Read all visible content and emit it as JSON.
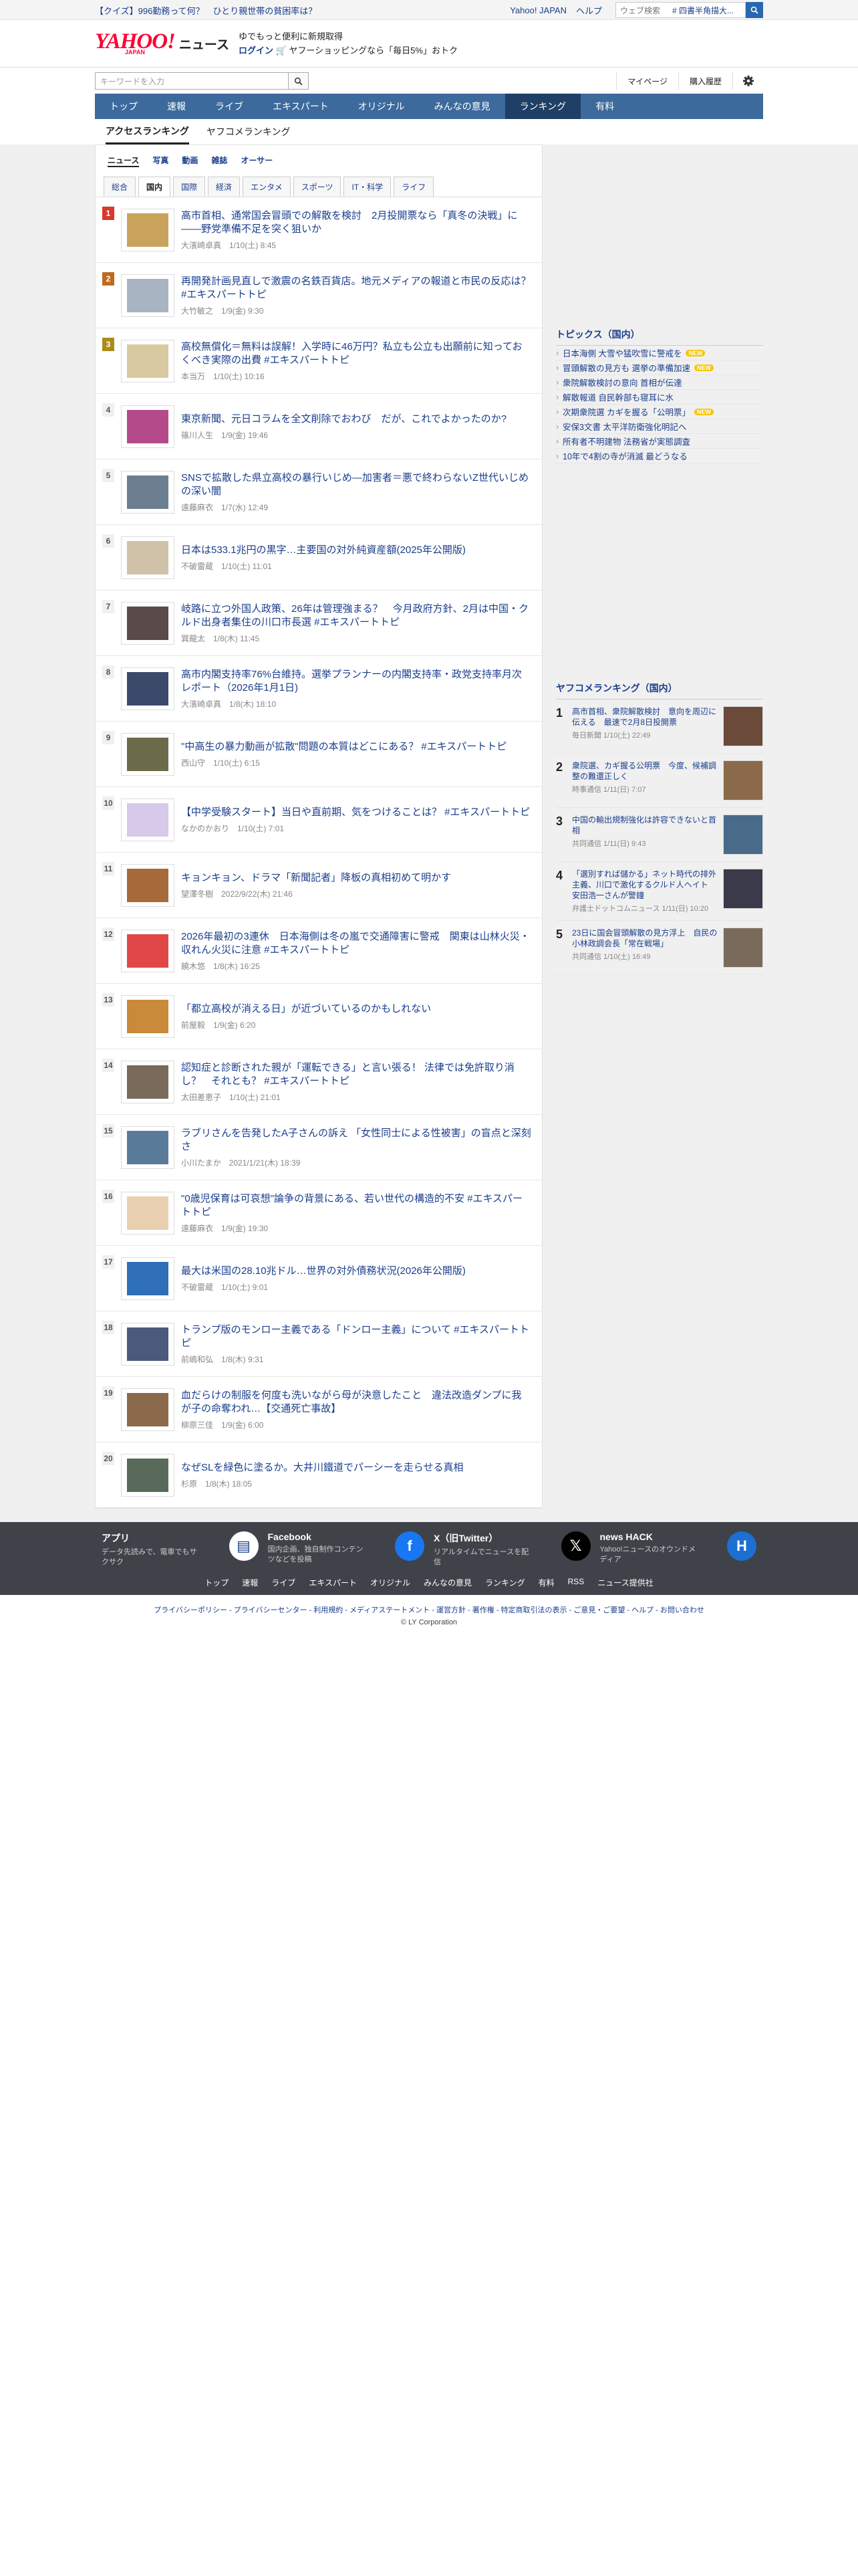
{
  "topbar": {
    "promo": "【クイズ】996勤務って何？　ひとり親世帯の貧困率は？",
    "links": [
      "Yahoo! JAPAN",
      "ヘルプ"
    ],
    "search_placeholder": "ウェブ検索",
    "search_value": "# 四書半角描大..."
  },
  "header": {
    "logo_text": "YAHOO!",
    "logo_sub": "JAPAN",
    "news_label": "ニュース",
    "msg1": "ゆでもっと便利に新規取得",
    "msg_highlight": "新規取得",
    "login": "ログイン",
    "msg2": "ヤフーショッピングなら「毎日5%」おトク"
  },
  "search": {
    "placeholder": "キーワードを入力",
    "mypage": "マイページ",
    "history": "購入履歴"
  },
  "gnav": [
    "トップ",
    "速報",
    "ライブ",
    "エキスパート",
    "オリジナル",
    "みんなの意見",
    "ランキング",
    "有料"
  ],
  "gnav_active": "ランキング",
  "subtabs": [
    "アクセスランキング",
    "ヤフコメランキング"
  ],
  "categories": [
    "ニュース",
    "写真",
    "動画",
    "雑誌",
    "オーサー"
  ],
  "genres": [
    "総合",
    "国内",
    "国際",
    "経済",
    "エンタメ",
    "スポーツ",
    "IT・科学",
    "ライフ"
  ],
  "genre_active": "国内",
  "articles": [
    {
      "rank": "1",
      "title": "高市首相、通常国会冒頭での解散を検討　2月投開票なら「真冬の決戦」に――野党準備不足を突く狙いか",
      "meta": "大濱崎卓真　1/10(土) 8:45"
    },
    {
      "rank": "2",
      "title": "再開発計画見直しで激震の名鉄百貨店。地元メディアの報道と市民の反応は？ #エキスパートトピ",
      "meta": "大竹敏之　1/9(金) 9:30"
    },
    {
      "rank": "3",
      "title": "高校無償化＝無料は誤解！入学時に46万円？私立も公立も出願前に知っておくべき実際の出費 #エキスパートトピ",
      "meta": "本当万　1/10(土) 10:16"
    },
    {
      "rank": "4",
      "title": "東京新聞、元日コラムを全文削除でおわび　だが、これでよかったのか?",
      "meta": "篠川人生　1/9(金) 19:46"
    },
    {
      "rank": "5",
      "title": "SNSで拡散した県立高校の暴行いじめ―加害者＝悪で終わらないZ世代いじめの深い闇",
      "meta": "遠藤麻衣　1/7(水) 12:49"
    },
    {
      "rank": "6",
      "title": "日本は533.1兆円の黒字…主要国の対外純資産額(2025年公開版)",
      "meta": "不破雷蔵　1/10(土) 11:01"
    },
    {
      "rank": "7",
      "title": "岐路に立つ外国人政策、26年は管理強まる？　今月政府方針、2月は中国・クルド出身者集住の川口市長選 #エキスパートトピ",
      "meta": "巽龍太　1/8(木) 11:45"
    },
    {
      "rank": "8",
      "title": "高市内閣支持率76%台維持。選挙プランナーの内閣支持率・政党支持率月次レポート（2026年1月1日)",
      "meta": "大濱崎卓真　1/8(木) 18:10"
    },
    {
      "rank": "9",
      "title": "\"中高生の暴力動画が拡散\"問題の本質はどこにある？ #エキスパートトピ",
      "meta": "西山守　1/10(土) 6:15"
    },
    {
      "rank": "10",
      "title": "【中学受験スタート】当日や直前期、気をつけることは？ #エキスパートトピ",
      "meta": "なかのかおり　1/10(土) 7:01"
    },
    {
      "rank": "11",
      "title": "キョンキョン、ドラマ「新聞記者」降板の真相初めて明かす",
      "meta": "望澤冬樹　2022/9/22(木) 21:46"
    },
    {
      "rank": "12",
      "title": "2026年最初の3連休　日本海側は冬の嵐で交通障害に警戒　関東は山林火災・収れん火災に注意 #エキスパートトピ",
      "meta": "饒木悠　1/8(木) 16:25"
    },
    {
      "rank": "13",
      "title": "「都立高校が消える日」が近づいているのかもしれない",
      "meta": "前屋毅　1/9(金) 6:20"
    },
    {
      "rank": "14",
      "title": "認知症と診断された親が「運転できる」と言い張る！ 法律では免許取り消し？　それとも？ #エキスパートトピ",
      "meta": "太田差恵子　1/10(土) 21:01"
    },
    {
      "rank": "15",
      "title": "ラブリさんを告発したA子さんの訴え 「女性同士による性被害」の盲点と深刻さ",
      "meta": "小川たまか　2021/1/21(木) 18:39"
    },
    {
      "rank": "16",
      "title": "\"0歳児保育は可哀想\"論争の背景にある、若い世代の構造的不安 #エキスパートトピ",
      "meta": "遠藤麻衣　1/9(金) 19:30"
    },
    {
      "rank": "17",
      "title": "最大は米国の28.10兆ドル…世界の対外債務状況(2026年公開版)",
      "meta": "不破雷蔵　1/10(土) 9:01"
    },
    {
      "rank": "18",
      "title": "トランプ版のモンロー主義である「ドンロー主義」について #エキスパートトピ",
      "meta": "前嶋和弘　1/8(木) 9:31"
    },
    {
      "rank": "19",
      "title": "血だらけの制服を何度も洗いながら母が決意したこと　違法改造ダンプに我が子の命奪われ…【交通死亡事故】",
      "meta": "柳原三佳　1/9(金) 6:00"
    },
    {
      "rank": "20",
      "title": "なぜSLを緑色に塗るか。大井川鐵道でパーシーを走らせる真相",
      "meta": "杉原　1/8(木) 18:05"
    }
  ],
  "topics": {
    "title": "トピックス（国内）",
    "new_label": "NEW",
    "items": [
      {
        "text": "日本海側 大雪や猛吹雪に警戒を",
        "new": true
      },
      {
        "text": "冒頭解散の見方も 選挙の準備加速",
        "new": true
      },
      {
        "text": "衆院解散検討の意向 首相が伝達",
        "new": false
      },
      {
        "text": "解散報道 自民幹部も寝耳に水",
        "new": false
      },
      {
        "text": "次期衆院選 カギを握る「公明票」",
        "new": true
      },
      {
        "text": "安保3文書 太平洋防衛強化明記へ",
        "new": false
      },
      {
        "text": "所有者不明建物 法務省が実態調査",
        "new": false
      },
      {
        "text": "10年で4割の寺が消滅 最どうなる",
        "new": false
      }
    ]
  },
  "yahoo_comment_ranking": {
    "title": "ヤフコメランキング（国内）",
    "items": [
      {
        "rank": "1",
        "title": "高市首相、衆院解散検討　意向を周辺に伝える　最速で2月8日投開票",
        "meta": "毎日新聞 1/10(土) 22:49"
      },
      {
        "rank": "2",
        "title": "衆院選、カギ握る公明票　今度、候補調整の難還正しく",
        "meta": "時事通信 1/11(日) 7:07"
      },
      {
        "rank": "3",
        "title": "中国の輸出規制強化は許容できないと首相",
        "meta": "共同通信 1/11(日) 9:43"
      },
      {
        "rank": "4",
        "title": "「選別すれば儲かる」ネット時代の排外主義、川口で激化するクルド人ヘイト　安田浩一さんが警鐘",
        "meta": "弁護士ドットコムニュース 1/11(日) 10:20"
      },
      {
        "rank": "5",
        "title": "23日に国会冒頭解散の見方浮上　自民の小林政調会長「常在戦場」",
        "meta": "共同通信 1/10(土) 16:49"
      }
    ]
  },
  "footer": {
    "apps": [
      {
        "name": "アプリ",
        "desc": "データ先読みで、電車でもサクサク",
        "icon": "app-icon"
      },
      {
        "name": "Facebook",
        "desc": "国内企画、独自制作コンテンツなどを投稿",
        "icon": "facebook-icon"
      },
      {
        "name": "X（旧Twitter）",
        "desc": "リアルタイムでニュースを配信",
        "icon": "x-icon"
      },
      {
        "name": "news HACK",
        "desc": "Yahoo!ニュースのオウンドメディア",
        "icon": "newshack-icon"
      }
    ],
    "links": [
      "トップ",
      "速報",
      "ライブ",
      "エキスパート",
      "オリジナル",
      "みんなの意見",
      "ランキング",
      "有料",
      "RSS",
      "ニュース提供社"
    ],
    "legal": "プライバシーポリシー - プライバシーセンター - 利用規約 - メディアステートメント - 運営方針 - 著作権 - 特定商取引法の表示 - ご意見・ご要望 - ヘルプ - お問い合わせ",
    "copyright": "© LY Corporation"
  },
  "colors": {
    "accent": "#1a3e8c",
    "nav": "#3d6a9c",
    "rank1": "#d8392b",
    "rank2": "#c06a20",
    "rank3": "#ad8b19"
  }
}
